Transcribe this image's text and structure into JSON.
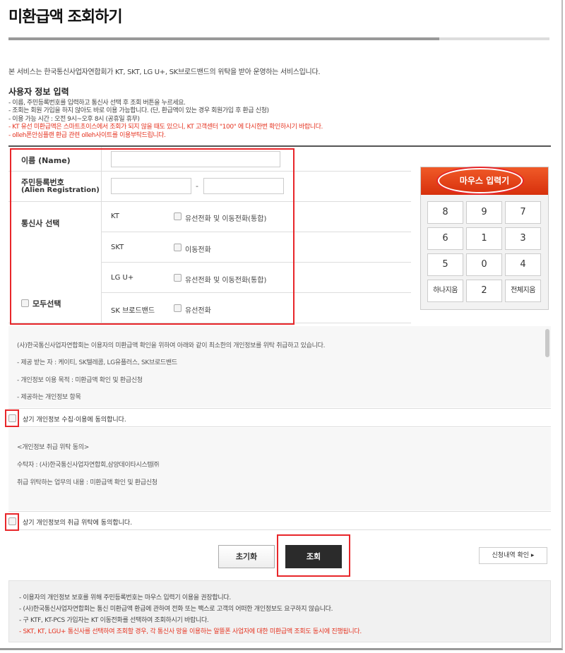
{
  "page": {
    "title": "미환급액 조회하기",
    "intro": "본 서비스는 한국통신사업자연합회가 KT, SKT, LG U+, SK브로드밴드의 위탁을 받아 운영하는 서비스입니다."
  },
  "user_info": {
    "heading": "사용자 정보 입력",
    "notes": [
      "- 이름, 주민등록번호를 입력하고 통신사 선택 후 조회 버튼을 누르세요.",
      "- 조회는 회원 가입을 하지 않아도 바로 이용 가능합니다. (단, 환급액이 있는 경우 회원가입 후 환급 신청)",
      "- 이용 가능 시간 : 오전 9시~오후 8시 (공휴일 휴무)",
      "- KT 유선 미환급액은 스마트초이스에서 조회가 되지 않을 때도 있으니, KT 고객센터 \"100\" 에 다시한번 확인하시기 바랍니다.",
      "- olleh폰안심플랜 환급 관련 olleh사이트를 이용부탁드립니다."
    ]
  },
  "form": {
    "name_label": "이름 (Name)",
    "name_value": "",
    "rrn_label": "주민등록번호",
    "rrn_sublabel": "(Alien Registration)",
    "rrn_front_value": "",
    "rrn_back_value": "",
    "dash": "-",
    "carrier_label": "통신사 선택",
    "select_all_label": "모두선택",
    "carriers": [
      {
        "name": "KT",
        "option": "유선전화 및 이동전화(통합)"
      },
      {
        "name": "SKT",
        "option": "이동전화"
      },
      {
        "name": "LG U+",
        "option": "유선전화 및 이동전화(통합)"
      },
      {
        "name": "SK 브로드밴드",
        "option": "유선전화"
      }
    ]
  },
  "keypad": {
    "title": "마우스 입력기",
    "keys": [
      "8",
      "9",
      "7",
      "6",
      "1",
      "3",
      "5",
      "0",
      "4",
      "하나지움",
      "2",
      "전체지움"
    ]
  },
  "agreement": {
    "privacy_lines": [
      "(사)한국통신사업자연합회는 이용자의 미환급액 확인을 위하여 아래와 같이 최소한의 개인정보를 위탁 취급하고 있습니다.",
      "- 제공 받는 자 : 케이티, SK텔레콤, LG유플러스, SK브로드밴드",
      "- 개인정보 이용 목적 : 미환급액 확인 및 환급신청",
      "- 제공하는 개인정보 항목"
    ],
    "consent1_label": "상기 개인정보 수집·이용에 동의합니다.",
    "entrust_lines": [
      "<개인정보 취급 위탁 동의>",
      "수탁자 : (사)한국통신사업자연합회,삼양데이타시스템㈜",
      "취급 위탁하는 업무의 내용 : 미환급액 확인 및 환급신청"
    ],
    "consent2_label": "상기 개인정보의 취급 위탁에 동의합니다."
  },
  "buttons": {
    "reset": "초기화",
    "search": "조회",
    "history": "신청내역 확인 ▸"
  },
  "notice": {
    "lines": [
      "- 이용자의 개인정보 보호를 위해 주민등록번호는 마우스 입력기 이용을 권장합니다.",
      "- (사)한국통신사업자연합회는 통신 미환급액 환급에 관하여 전화 또는 팩스로 고객의 어떠한 개인정보도 요구하지 않습니다.",
      "- 구 KTF, KT-PCS 가입자는 KT 이동전화를 선택하여 조회하시기 바랍니다."
    ],
    "red_line": "- SKT, KT, LGU+ 통신사를 선택하여 조회할 경우, 각 통신사 망을 이용하는 알뜰폰 사업자에 대한 미환급액 조회도 동시에 진행됩니다."
  },
  "colors": {
    "accent": "#e8360f",
    "highlight": "#e8262a",
    "warning_text": "#e53320"
  }
}
